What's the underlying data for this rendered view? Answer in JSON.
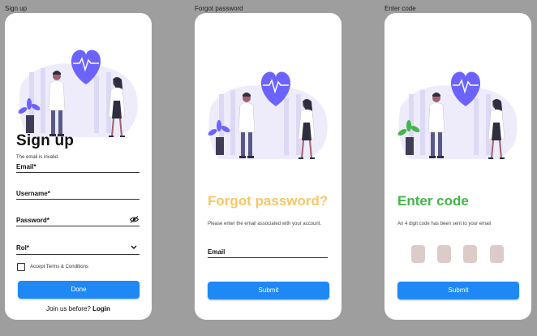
{
  "frames": {
    "signup": "Sign up",
    "forgot": "Forgot password",
    "code": "Enter code"
  },
  "signup": {
    "title": "Sign up",
    "error": "The email is invalid.",
    "email_label": "Email*",
    "username_label": "Username*",
    "password_label": "Password*",
    "role_label": "Rol*",
    "terms_label": "Accept Terms & Conditions",
    "done_label": "Done",
    "footer_prefix": "Join us before?",
    "footer_link": "Login"
  },
  "forgot": {
    "title": "Forgot password?",
    "description": "Please enter the email associated with your account.",
    "email_label": "Email",
    "submit_label": "Submit"
  },
  "code": {
    "title": "Enter code",
    "description": "An 4 digit code has been sent to your email",
    "submit_label": "Submit"
  },
  "colors": {
    "accent": "#1e88f5",
    "forgot_title": "#f7c768",
    "code_title": "#43b649",
    "heart": "#6c63ff",
    "code_box": "#dccbc8"
  },
  "icons": [
    "heart-icon",
    "eye-off-icon",
    "chevron-down-icon"
  ]
}
